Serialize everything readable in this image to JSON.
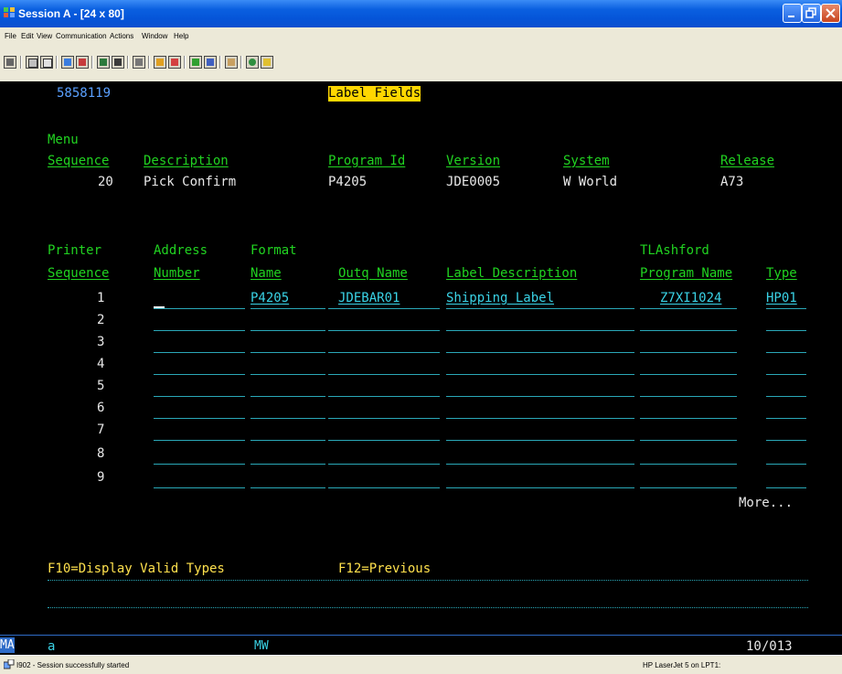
{
  "window": {
    "title": "Session A - [24 x 80]"
  },
  "menu": [
    "File",
    "Edit",
    "View",
    "Communication",
    "Actions",
    "Window",
    "Help"
  ],
  "screen": {
    "id": "5858119",
    "title": "Label Fields",
    "menu_label": "Menu",
    "headers": {
      "sequence": "Sequence",
      "description": "Description",
      "program_id": "Program Id",
      "version": "Version",
      "system": "System",
      "release": "Release"
    },
    "row": {
      "sequence": "20",
      "description": "Pick Confirm",
      "program_id": "P4205",
      "version": "JDE0005",
      "system": "W World",
      "release": "A73"
    },
    "grid_headers_top": {
      "printer": "Printer",
      "address": "Address",
      "format": "Format",
      "tl": "TLAshford"
    },
    "grid_headers": {
      "sequence": "Sequence",
      "number": "Number",
      "name": "Name",
      "outq": "Outq Name",
      "label_desc": "Label Description",
      "program_name": "Program Name",
      "type": "Type"
    },
    "rows": [
      {
        "seq": "1",
        "format": "P4205",
        "outq": "JDEBAR01",
        "label": "Shipping Label",
        "program": "Z7XI1024",
        "type": "HP01"
      },
      {
        "seq": "2"
      },
      {
        "seq": "3"
      },
      {
        "seq": "4"
      },
      {
        "seq": "5"
      },
      {
        "seq": "6"
      },
      {
        "seq": "7"
      },
      {
        "seq": "8"
      },
      {
        "seq": "9"
      }
    ],
    "more": "More...",
    "fkeys": {
      "f10": "F10=Display Valid Types",
      "f12": "F12=Previous"
    }
  },
  "oia": {
    "left": "MA",
    "a": "a",
    "mw": "MW",
    "pos": "10/013"
  },
  "statusbar": {
    "left": "I902 - Session successfully started",
    "right": "HP LaserJet 5 on LPT1:"
  }
}
